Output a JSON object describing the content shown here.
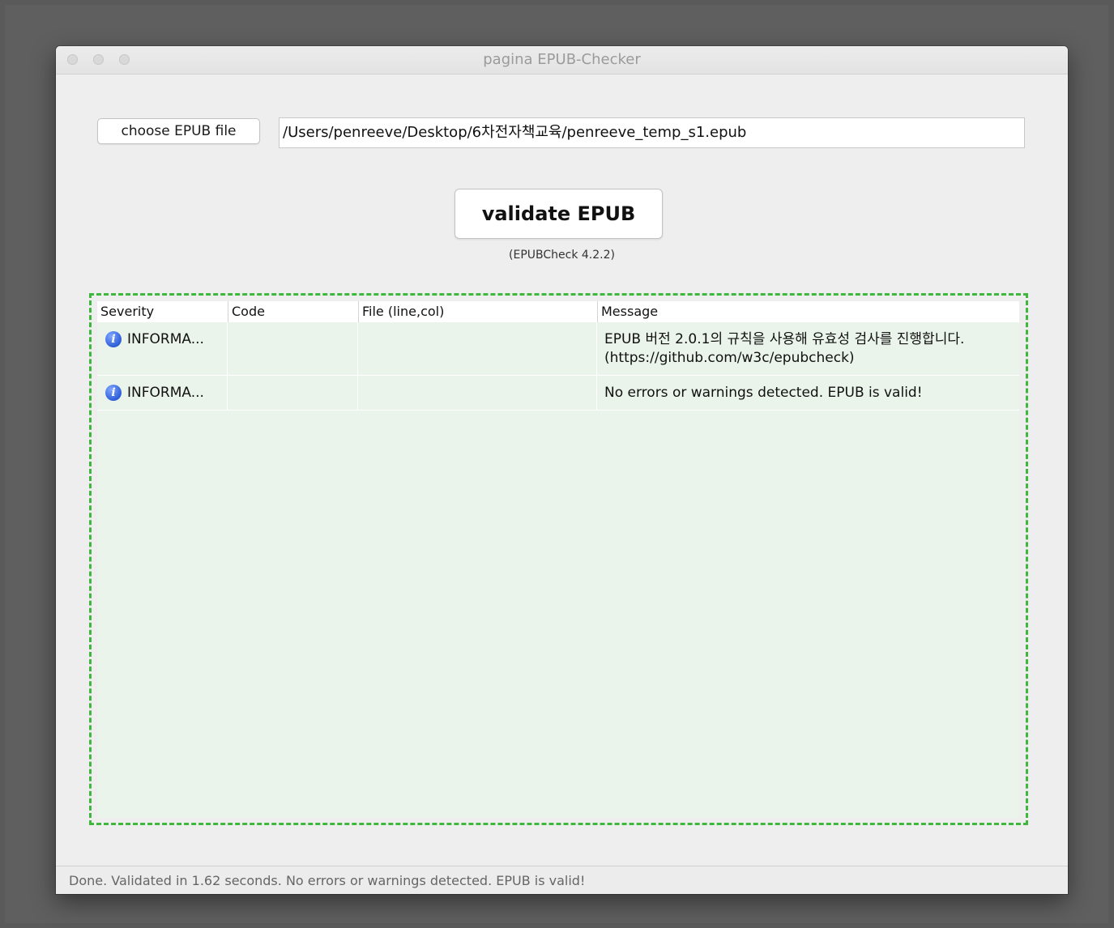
{
  "window": {
    "title": "pagina EPUB-Checker"
  },
  "file": {
    "choose_label": "choose EPUB file",
    "path_value": "/Users/penreeve/Desktop/6차전자책교육/penreeve_temp_s1.epub"
  },
  "validate": {
    "label": "validate EPUB",
    "version": "(EPUBCheck 4.2.2)"
  },
  "table": {
    "headers": {
      "severity": "Severity",
      "code": "Code",
      "file": "File (line,col)",
      "message": "Message"
    },
    "rows": [
      {
        "severity": "INFORMA...",
        "icon": "info-icon",
        "code": "",
        "file": "",
        "message_line1": "EPUB 버전 2.0.1의 규칙을 사용해 유효성 검사를 진행합니다.",
        "message_line2": "(https://github.com/w3c/epubcheck)"
      },
      {
        "severity": "INFORMA...",
        "icon": "info-icon",
        "code": "",
        "file": "",
        "message_line1": "No errors or warnings detected. EPUB is valid!",
        "message_line2": ""
      }
    ]
  },
  "status": {
    "text": "Done. Validated in 1.62 seconds. No errors or warnings detected. EPUB is valid!"
  },
  "colors": {
    "drop_zone_border": "#3db83d",
    "row_background": "#eaf4ea",
    "info_icon": "#2f5fd8"
  }
}
